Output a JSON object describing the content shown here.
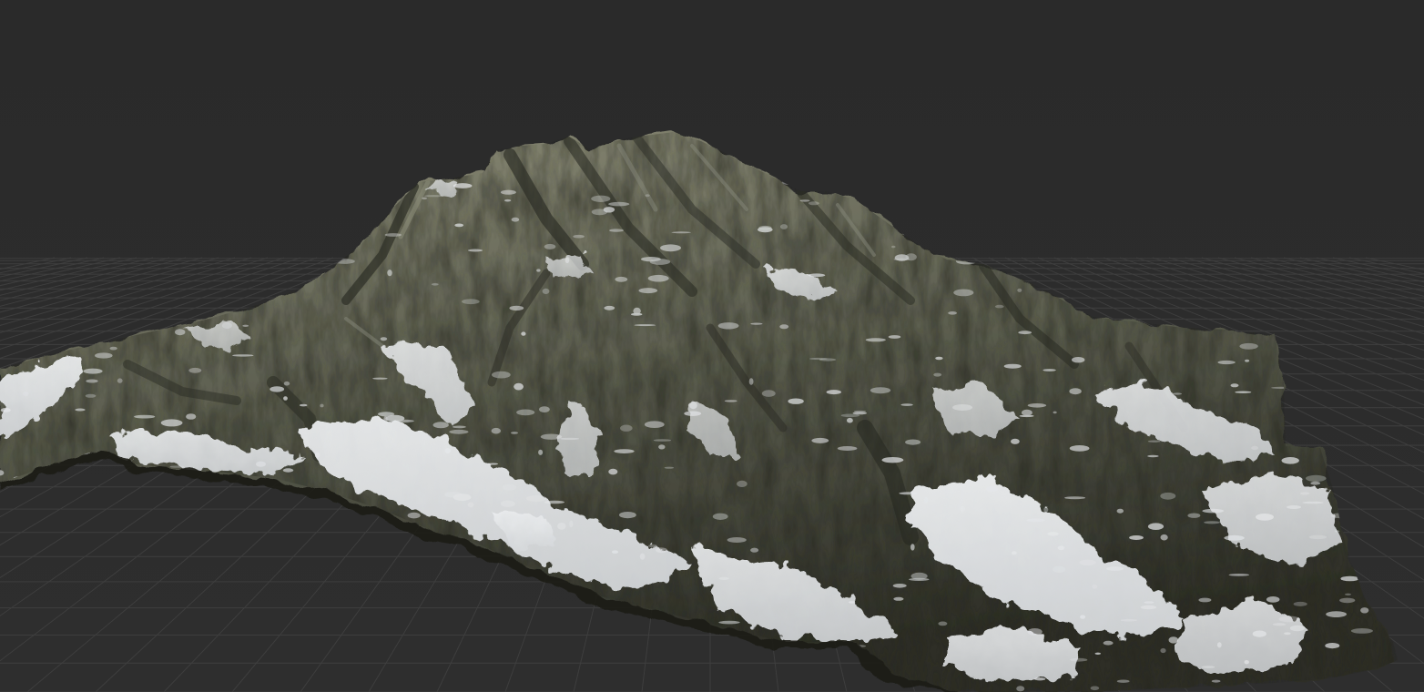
{
  "viewport": {
    "background_color": "#2b2b2b",
    "grid_color": "#3e3e3e",
    "grid_visible": true
  },
  "terrain": {
    "rock_color": "#5c5e4f",
    "rock_dark_color": "#2e2f27",
    "rock_light_color": "#8a8a76",
    "snow_color": "#e6e8ea",
    "snow_shadow_color": "#b9bcc0"
  }
}
